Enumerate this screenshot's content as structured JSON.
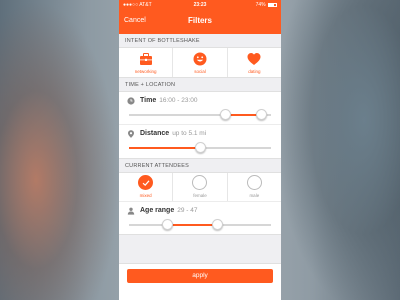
{
  "status_bar": {
    "carrier": "●●●○○ AT&T",
    "time": "23:23",
    "battery": "74%"
  },
  "nav": {
    "cancel_label": "Cancel",
    "title": "Filters"
  },
  "intent": {
    "header": "INTENT OF BOTTLESHAKE",
    "options": [
      {
        "label": "networking",
        "icon": "briefcase-icon"
      },
      {
        "label": "social",
        "icon": "smiley-icon"
      },
      {
        "label": "dating",
        "icon": "heart-icon"
      }
    ]
  },
  "time_location": {
    "header": "TIME + LOCATION",
    "time": {
      "label": "Time",
      "value": "16:00 - 23:00",
      "range_fraction": [
        0.68,
        0.93
      ],
      "icon": "clock-icon"
    },
    "distance": {
      "label": "Distance",
      "value": "up to 5.1 mi",
      "fraction": 0.5,
      "icon": "location-pin-icon"
    }
  },
  "attendees": {
    "header": "CURRENT ATTENDEES",
    "options": [
      {
        "label": "mixed",
        "checked": true
      },
      {
        "label": "female",
        "checked": false
      },
      {
        "label": "male",
        "checked": false
      }
    ],
    "age": {
      "label": "Age range",
      "value": "29 - 47",
      "range_fraction": [
        0.27,
        0.62
      ],
      "icon": "age-icon"
    }
  },
  "apply_label": "apply",
  "colors": {
    "accent": "#ff5a1f",
    "background": "#efeff2"
  }
}
